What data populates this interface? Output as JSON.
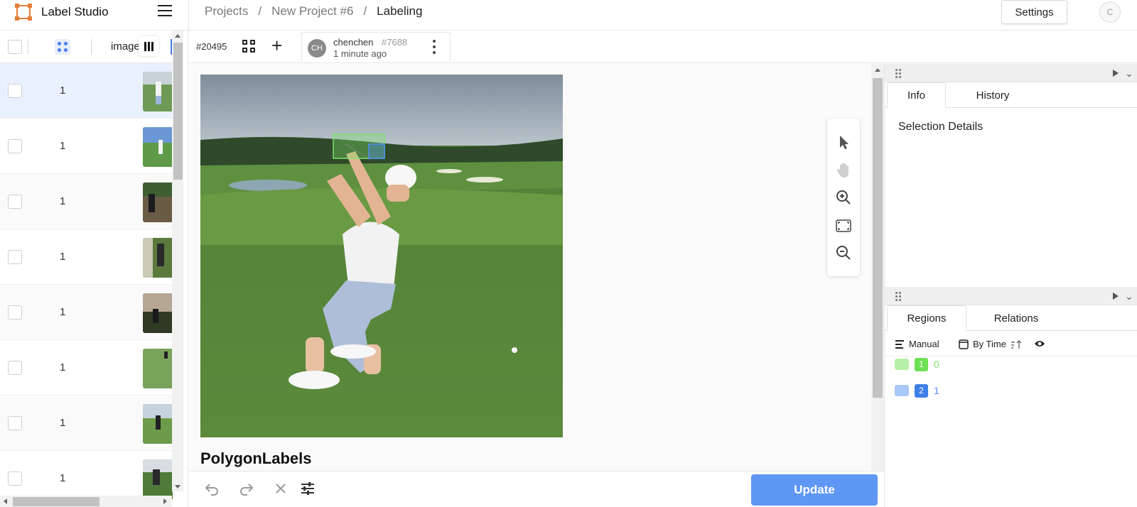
{
  "app": {
    "title": "Label Studio"
  },
  "breadcrumb": {
    "items": [
      "Projects",
      "New Project #6",
      "Labeling"
    ],
    "separator": "/"
  },
  "header": {
    "settings_label": "Settings",
    "user_initial": "C"
  },
  "task_list": {
    "column_label": "image",
    "rows": [
      {
        "value": "1",
        "selected": true
      },
      {
        "value": "1"
      },
      {
        "value": "1"
      },
      {
        "value": "1"
      },
      {
        "value": "1"
      },
      {
        "value": "1"
      },
      {
        "value": "1"
      },
      {
        "value": "1"
      }
    ]
  },
  "annotation_bar": {
    "task_id": "#20495",
    "annotator_initials": "CH",
    "annotator_name": "chenchen",
    "annotation_id": "#7688",
    "time_ago": "1 minute ago"
  },
  "canvas": {
    "label_section_title": "PolygonLabels"
  },
  "bottom": {
    "update_label": "Update"
  },
  "info_panel": {
    "tabs": [
      "Info",
      "History"
    ],
    "active_tab": "Info",
    "selection_title": "Selection Details"
  },
  "regions_panel": {
    "tabs": [
      "Regions",
      "Relations"
    ],
    "active_tab": "Regions",
    "order_label": "Manual",
    "sort_label": "By Time",
    "regions": [
      {
        "index": "1",
        "label": "0",
        "color": "#7ee36b",
        "badge_color": "#6ee054"
      },
      {
        "index": "2",
        "label": "1",
        "color": "#4f8ef7",
        "badge_color": "#3f7fe8"
      }
    ]
  },
  "colors": {
    "accent": "#5f97f5",
    "selected_row": "#e9f1fe"
  }
}
